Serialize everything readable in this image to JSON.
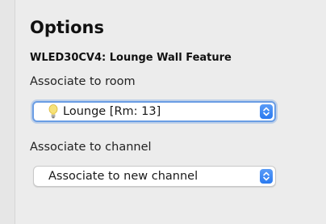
{
  "panel": {
    "title": "Options",
    "device_name": "WLED30CV4: Lounge Wall Feature"
  },
  "room": {
    "label": "Associate to room",
    "selected": "Lounge [Rm: 13]",
    "icon": "lightbulb-icon"
  },
  "channel": {
    "label": "Associate to channel",
    "selected": "Associate to new channel"
  },
  "colors": {
    "focus_ring": "#6a9de4",
    "stepper": "#2a7af0"
  }
}
